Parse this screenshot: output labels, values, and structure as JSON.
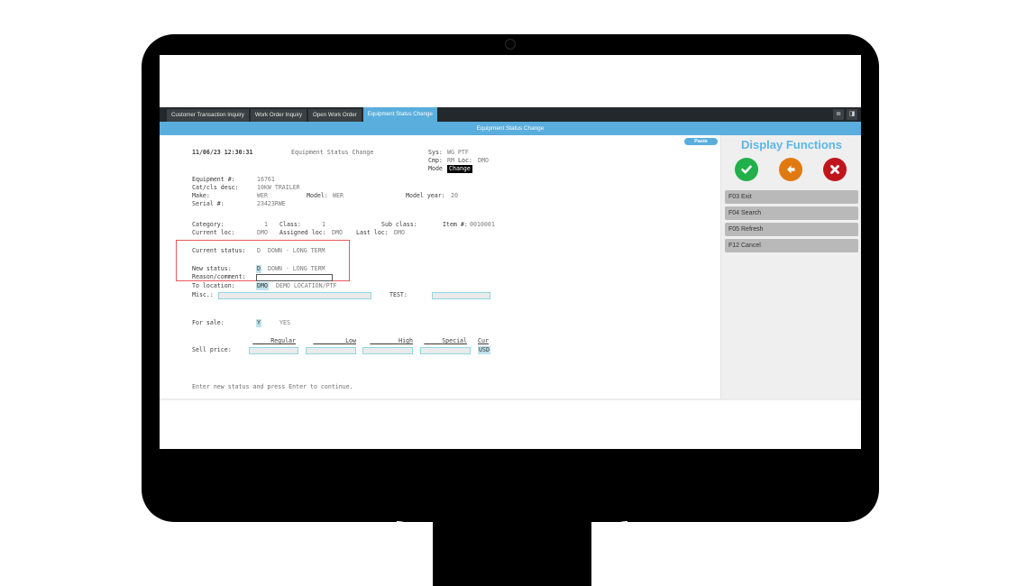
{
  "tabs": [
    {
      "label": "Customer Transaction Inquiry",
      "active": false
    },
    {
      "label": "Work Order Inquiry",
      "active": false
    },
    {
      "label": "Open Work Order",
      "active": false
    },
    {
      "label": "Equipment Status Change",
      "active": true
    }
  ],
  "tab_tools": {
    "list_icon": "≣",
    "page_icon": "◨"
  },
  "window_title": "Equipment Status Change",
  "header": {
    "datetime": "11/06/23 12:30:31",
    "screen_title": "Equipment Status Change",
    "sys_label": "Sys:",
    "sys_value": "WG PTF",
    "cmp_label": "Cmp:",
    "cmp_value": "RM",
    "loc_label": "Loc:",
    "loc_value": "DMO",
    "mode_label": "Mode",
    "mode_value": "Change"
  },
  "fields": {
    "equipment_label": "Equipment #:",
    "equipment_value": "16761",
    "catcls_label": "Cat/cls desc:",
    "catcls_value": "10KW TRAILER",
    "make_label": "Make:",
    "make_value": "WER",
    "model_label": "Model:",
    "model_value": "WER",
    "model_year_label": "Model year:",
    "model_year_value": "20",
    "serial_label": "Serial #:",
    "serial_value": "23423RWE",
    "category_label": "Category:",
    "category_value": "1",
    "class_label": "Class:",
    "class_value": "1",
    "subclass_label": "Sub class:",
    "subclass_value": "",
    "item_label": "Item #:",
    "item_value": "0010001",
    "current_loc_label": "Current loc:",
    "current_loc_value": "DMO",
    "assigned_loc_label": "Assigned loc:",
    "assigned_loc_value": "DMO",
    "last_loc_label": "Last loc:",
    "last_loc_value": "DMO",
    "current_status_label": "Current status:",
    "current_status_code": "D",
    "current_status_desc": "DOWN - LONG TERM",
    "new_status_label": "New status:",
    "new_status_code": "D",
    "new_status_desc": "DOWN - LONG TERM",
    "reason_label": "Reason/comment:",
    "reason_value": "",
    "to_location_label": "To location:",
    "to_location_code": "DMO",
    "to_location_desc": "DEMO LOCATION/PTF",
    "misc_label": "Misc.:",
    "misc_value": "",
    "test_label": "TEST:",
    "test_value": "",
    "for_sale_label": "For sale:",
    "for_sale_code": "Y",
    "for_sale_desc": "YES",
    "sell_price_label": "Sell price:",
    "price_headers": [
      "Regular",
      "Low",
      "High",
      "Special",
      "Cur"
    ],
    "price_values": [
      "",
      "",
      "",
      ""
    ],
    "currency": "USD"
  },
  "status_message": "Enter new status and press Enter to continue.",
  "paste_label": "Paste",
  "side_panel": {
    "title": "Display Functions",
    "icon_buttons": [
      {
        "name": "confirm",
        "color": "#22b04a"
      },
      {
        "name": "back",
        "color": "#e07a10"
      },
      {
        "name": "cancel",
        "color": "#c0141c"
      }
    ],
    "functions": [
      {
        "label": "F03  Exit"
      },
      {
        "label": "F04  Search"
      },
      {
        "label": "F05  Refresh"
      },
      {
        "label": "F12  Cancel"
      }
    ]
  }
}
